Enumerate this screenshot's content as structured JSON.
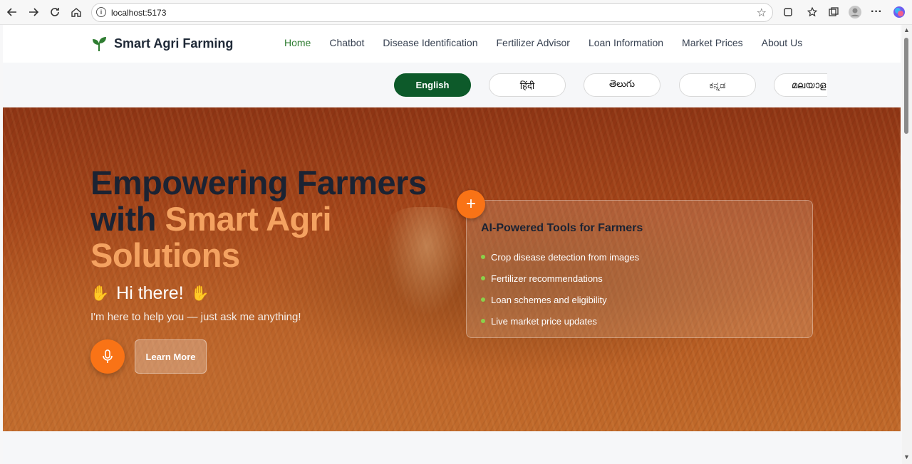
{
  "browser": {
    "url": "localhost:5173",
    "icons": [
      "back-icon",
      "forward-icon",
      "refresh-icon",
      "home-icon",
      "info-icon",
      "star-icon",
      "extensions-icon",
      "favorites-icon",
      "collections-icon",
      "profile-icon",
      "more-icon",
      "copilot-icon"
    ]
  },
  "navbar": {
    "brand": "Smart Agri Farming",
    "links": [
      "Home",
      "Chatbot",
      "Disease Identification",
      "Fertilizer Advisor",
      "Loan Information",
      "Market Prices",
      "About Us"
    ],
    "active": "Home"
  },
  "languages": {
    "items": [
      "English",
      "हिंदी",
      "తెలుగు",
      "ಕನ್ನಡ",
      "മലയാള"
    ],
    "active": "English"
  },
  "hero": {
    "title_dark": "Empowering Farmers with",
    "title_accent": "Smart Agri Solutions",
    "greeting": "Hi there!",
    "subtitle": "I'm here to help you — just ask me anything!",
    "learn_more": "Learn More"
  },
  "tools": {
    "title": "AI-Powered Tools for Farmers",
    "items": [
      "Crop disease detection from images",
      "Fertilizer recommendations",
      "Loan schemes and eligibility",
      "Live market price updates"
    ]
  },
  "colors": {
    "brand_green": "#2f7d32",
    "active_lang": "#0d5a2a",
    "accent_orange": "#f97316",
    "accent_text": "#f4a261"
  }
}
